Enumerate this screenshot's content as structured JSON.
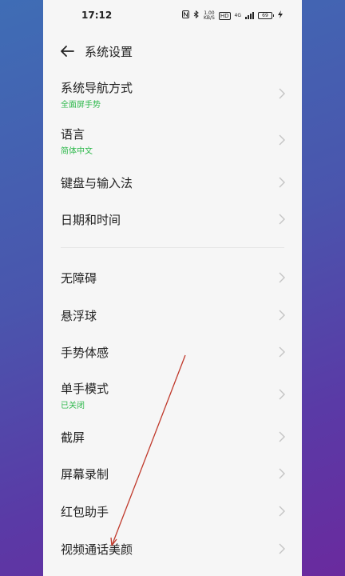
{
  "status_bar": {
    "time": "17:12",
    "nfc_icon": "nfc-icon",
    "bluetooth_icon": "bluetooth-icon",
    "net_speed_value": "1.00",
    "net_speed_unit": "KB/S",
    "hd_label": "HD",
    "signal_label": "4G",
    "battery": "69"
  },
  "header": {
    "back_icon": "arrow-left-icon",
    "title": "系统设置"
  },
  "settings_items": [
    {
      "title": "系统导航方式",
      "subtitle": "全面屏手势"
    },
    {
      "title": "语言",
      "subtitle": "简体中文"
    },
    {
      "title": "键盘与输入法",
      "subtitle": ""
    },
    {
      "title": "日期和时间",
      "subtitle": ""
    },
    {
      "title": "无障碍",
      "subtitle": ""
    },
    {
      "title": "悬浮球",
      "subtitle": ""
    },
    {
      "title": "手势体感",
      "subtitle": ""
    },
    {
      "title": "单手模式",
      "subtitle": "已关闭"
    },
    {
      "title": "截屏",
      "subtitle": ""
    },
    {
      "title": "屏幕录制",
      "subtitle": ""
    },
    {
      "title": "红包助手",
      "subtitle": ""
    },
    {
      "title": "视频通话美颜",
      "subtitle": ""
    }
  ],
  "colors": {
    "subtitle_green": "#2db84b",
    "annotation_red": "#c0392b"
  }
}
